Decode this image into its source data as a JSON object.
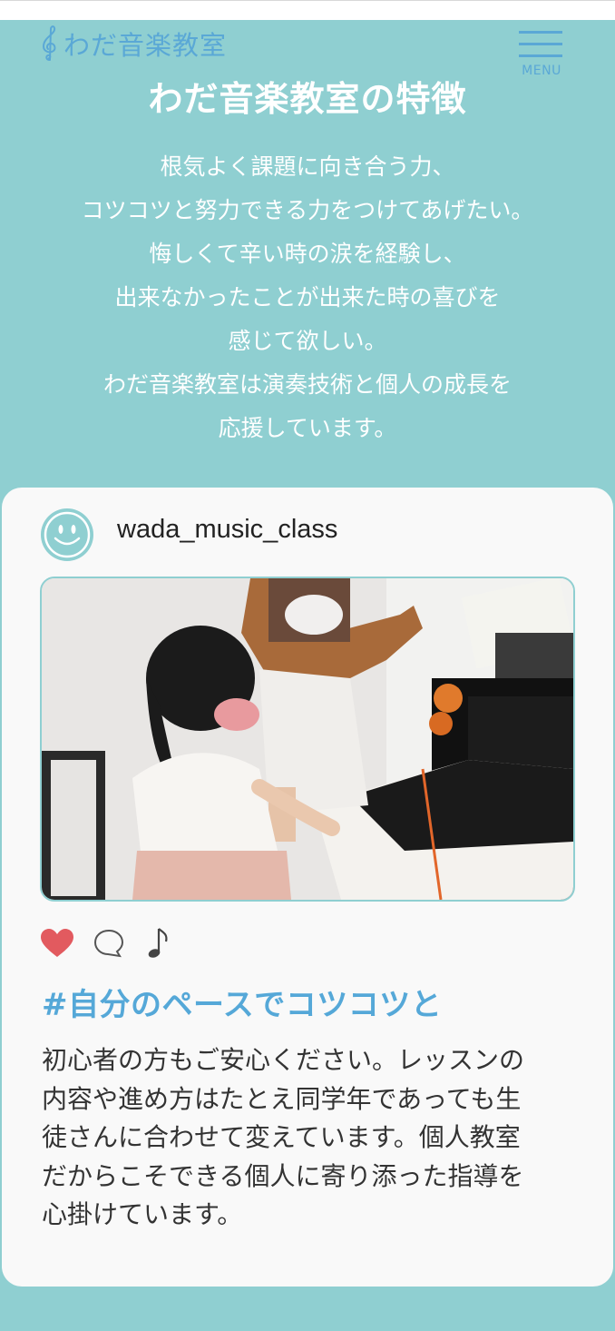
{
  "header": {
    "logo_text": "わだ音楽教室",
    "logo_icon": "treble-clef-icon",
    "menu_label": "MENU",
    "menu_icon": "hamburger-icon"
  },
  "features": {
    "title": "わだ音楽教室の特徴",
    "intro_lines": [
      "根気よく課題に向き合う力、",
      "コツコツと努力できる力をつけてあげたい。",
      "悔しくて辛い時の涙を経験し、",
      "出来なかったことが出来た時の喜びを",
      "感じて欲しい。",
      "わだ音楽教室は演奏技術と個人の成長を",
      "応援しています。"
    ]
  },
  "post": {
    "avatar_icon": "smiley-face-icon",
    "username": "wada_music_class",
    "photo_alt": "piano lesson photo",
    "actions": {
      "like_icon": "heart-icon",
      "comment_icon": "speech-bubble-icon",
      "music_icon": "music-note-icon"
    },
    "hashtag": "#自分のペースでコツコツと",
    "body_lines": [
      "初心者の方もご安心ください。レッスンの",
      "内容や進め方はたとえ同学年であっても生",
      "徒さんに合わせて変えています。個人教室",
      "だからこそできる個人に寄り添った指導を",
      "心掛けています。"
    ]
  },
  "colors": {
    "background": "#8fcfd1",
    "card": "#f9f9f9",
    "accent_blue": "#55a8d8",
    "heart": "#e25a5f"
  }
}
